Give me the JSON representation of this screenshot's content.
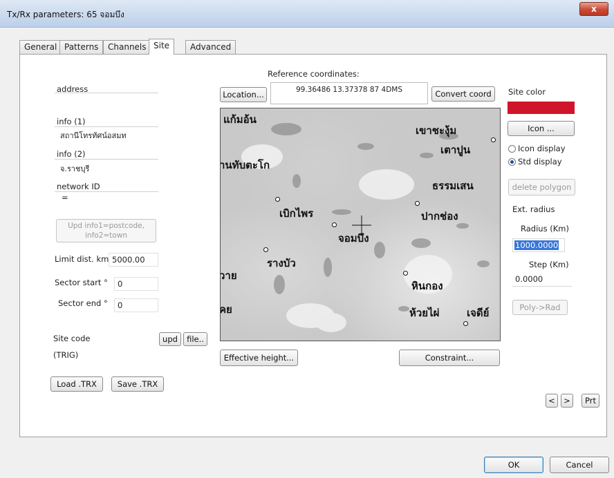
{
  "window": {
    "title": "Tx/Rx parameters: 65 จอมบึง",
    "close_label": "x"
  },
  "tabs": [
    {
      "label": "General"
    },
    {
      "label": "Patterns"
    },
    {
      "label": "Channels"
    },
    {
      "label": "Site"
    },
    {
      "label": "Advanced"
    }
  ],
  "left": {
    "address_label": "address",
    "info1_label": "info (1)",
    "info1_value": "สถานีโทรทัศน์อสมท",
    "info2_label": "info (2)",
    "info2_value": "จ.ราชบุรี",
    "network_label": "network ID",
    "network_value": "=",
    "upd_info_button": "Upd info1=postcode,\ninfo2=town",
    "limit_label": "Limit dist. km",
    "limit_value": "5000.00",
    "sector_start_label": "Sector start °",
    "sector_start_value": "0",
    "sector_end_label": "Sector end °",
    "sector_end_value": "0",
    "site_code_label": "Site code",
    "upd_button": "upd",
    "file_button": "file..",
    "site_code_value": "(TRIG)",
    "load_button": "Load .TRX",
    "save_button": "Save .TRX"
  },
  "center": {
    "ref_label": "Reference coordinates:",
    "location_button": "Location...",
    "coords": "99.36486 13.37378 87 4DMS",
    "convert_button": "Convert coord",
    "effective_button": "Effective height...",
    "constraint_button": "Constraint..."
  },
  "map": {
    "labels": [
      {
        "text": "แก้มอ้น"
      },
      {
        "text": "เขาชะงุ้ม"
      },
      {
        "text": "เตาปูน"
      },
      {
        "text": "านทับตะโก"
      },
      {
        "text": "ธรรมเสน"
      },
      {
        "text": "เบิกไพร"
      },
      {
        "text": "ปากช่อง"
      },
      {
        "text": "จอมบึง"
      },
      {
        "text": "รางบัว"
      },
      {
        "text": "วาย"
      },
      {
        "text": "หินกอง"
      },
      {
        "text": "คย"
      },
      {
        "text": "ห้วยไผ่"
      },
      {
        "text": "เจดีย์"
      }
    ]
  },
  "right": {
    "site_color_label": "Site color",
    "site_color": "#d0152a",
    "icon_button": "Icon ...",
    "icon_display_label": "Icon display",
    "std_display_label": "Std display",
    "delete_polygon_button": "delete polygon",
    "ext_radius_label": "Ext. radius",
    "radius_label": "Radius (Km)",
    "radius_value": "1000.0000",
    "step_label": "Step (Km)",
    "step_value": "0.0000",
    "poly_rad_button": "Poly->Rad",
    "prev_button": "<",
    "next_button": ">",
    "prt_button": "Prt"
  },
  "footer": {
    "ok_button": "OK",
    "cancel_button": "Cancel"
  }
}
